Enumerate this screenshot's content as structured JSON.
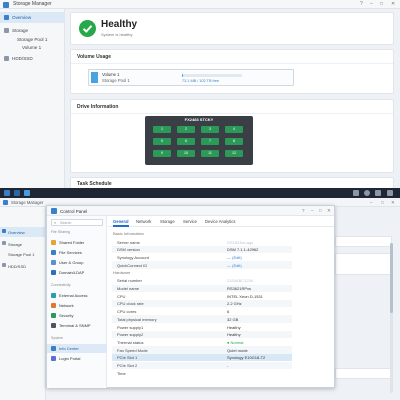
{
  "top_window": {
    "title": "Storage Manager",
    "sidebar": {
      "items": [
        {
          "label": "Overview"
        },
        {
          "label": "Storage"
        },
        {
          "label": "Storage Pool 1"
        },
        {
          "label": "Volume 1"
        },
        {
          "label": "HDD/SSD"
        }
      ]
    },
    "status": {
      "title": "Healthy",
      "subtitle": "System is healthy."
    },
    "volume_usage": {
      "heading": "Volume Usage",
      "volume": "Volume 1",
      "pool": "Storage Pool 1",
      "usage_text": "73.1 MB / 102 TB free",
      "usage_fraction": 0.01
    },
    "drive_info": {
      "heading": "Drive Information",
      "model": "FX2483 STCKY",
      "bays": [
        "1",
        "2",
        "3",
        "4",
        "5",
        "6",
        "7",
        "8",
        "9",
        "10",
        "11",
        "12"
      ]
    },
    "task_schedule": {
      "heading": "Task Schedule"
    }
  },
  "bg_window": {
    "title": "Storage Manager",
    "sidebar": {
      "items": [
        {
          "label": "Overview"
        },
        {
          "label": "Storage"
        },
        {
          "label": "Storage Pool 1"
        },
        {
          "label": "HDD/SSD"
        }
      ]
    }
  },
  "control_panel": {
    "title": "Control Panel",
    "search_placeholder": "Search",
    "sidebar": {
      "groups": [
        {
          "label": "File Sharing",
          "items": [
            {
              "label": "Shared Folder",
              "color": "#e6a23c"
            },
            {
              "label": "File Services",
              "color": "#3a80c8"
            },
            {
              "label": "User & Group",
              "color": "#5b8fd9"
            },
            {
              "label": "Domain/LDAP",
              "color": "#2f6fb8"
            }
          ]
        },
        {
          "label": "Connectivity",
          "items": [
            {
              "label": "External Access",
              "color": "#27a0a8"
            },
            {
              "label": "Network",
              "color": "#e07a2b"
            },
            {
              "label": "Security",
              "color": "#2b9a58"
            },
            {
              "label": "Terminal & SNMP",
              "color": "#4b5563"
            }
          ]
        },
        {
          "label": "System",
          "items": [
            {
              "label": "Info Center",
              "color": "#3a80c8"
            },
            {
              "label": "Login Portal",
              "color": "#5b6ee0"
            }
          ]
        }
      ]
    },
    "tabs": [
      "General",
      "Network",
      "Storage",
      "Service",
      "Device Analytics"
    ],
    "active_tab": "General",
    "sections": {
      "basic": "Basic Information",
      "hardware": "Hardware"
    },
    "basic_rows": [
      {
        "key": "Server name",
        "value": "DS1823xs-ags",
        "style": "blur"
      },
      {
        "key": "DSM version",
        "value": "DSM 7.1.1-42962",
        "style": ""
      },
      {
        "key": "Synology Account",
        "value": "— (Edit)",
        "style": "link"
      },
      {
        "key": "QuickConnect ID",
        "value": "— (Edit)",
        "style": "link"
      }
    ],
    "hardware_rows": [
      {
        "key": "Serial number",
        "value": "2320ABC1234",
        "style": "blur"
      },
      {
        "key": "Model name",
        "value": "RS3621RPxs",
        "style": ""
      },
      {
        "key": "CPU",
        "value": "INTEL Xeon D-1531",
        "style": ""
      },
      {
        "key": "CPU clock rate",
        "value": "2.2 GHz",
        "style": ""
      },
      {
        "key": "CPU cores",
        "value": "6",
        "style": ""
      },
      {
        "key": "Total physical memory",
        "value": "32 GB",
        "style": ""
      },
      {
        "key": "Power supply1",
        "value": "Healthy",
        "style": ""
      },
      {
        "key": "Power supply2",
        "value": "Healthy",
        "style": ""
      },
      {
        "key": "Thermal status",
        "value": "● Normal",
        "style": "ok"
      },
      {
        "key": "Fan Speed Mode",
        "value": "Quiet mode",
        "style": ""
      },
      {
        "key": "PCIe Slot 1",
        "value": "Synology E10G18-T2",
        "style": "",
        "highlight": true
      },
      {
        "key": "PCIe Slot 2",
        "value": "-",
        "style": ""
      },
      {
        "key": "Time",
        "value": "",
        "style": ""
      }
    ]
  }
}
